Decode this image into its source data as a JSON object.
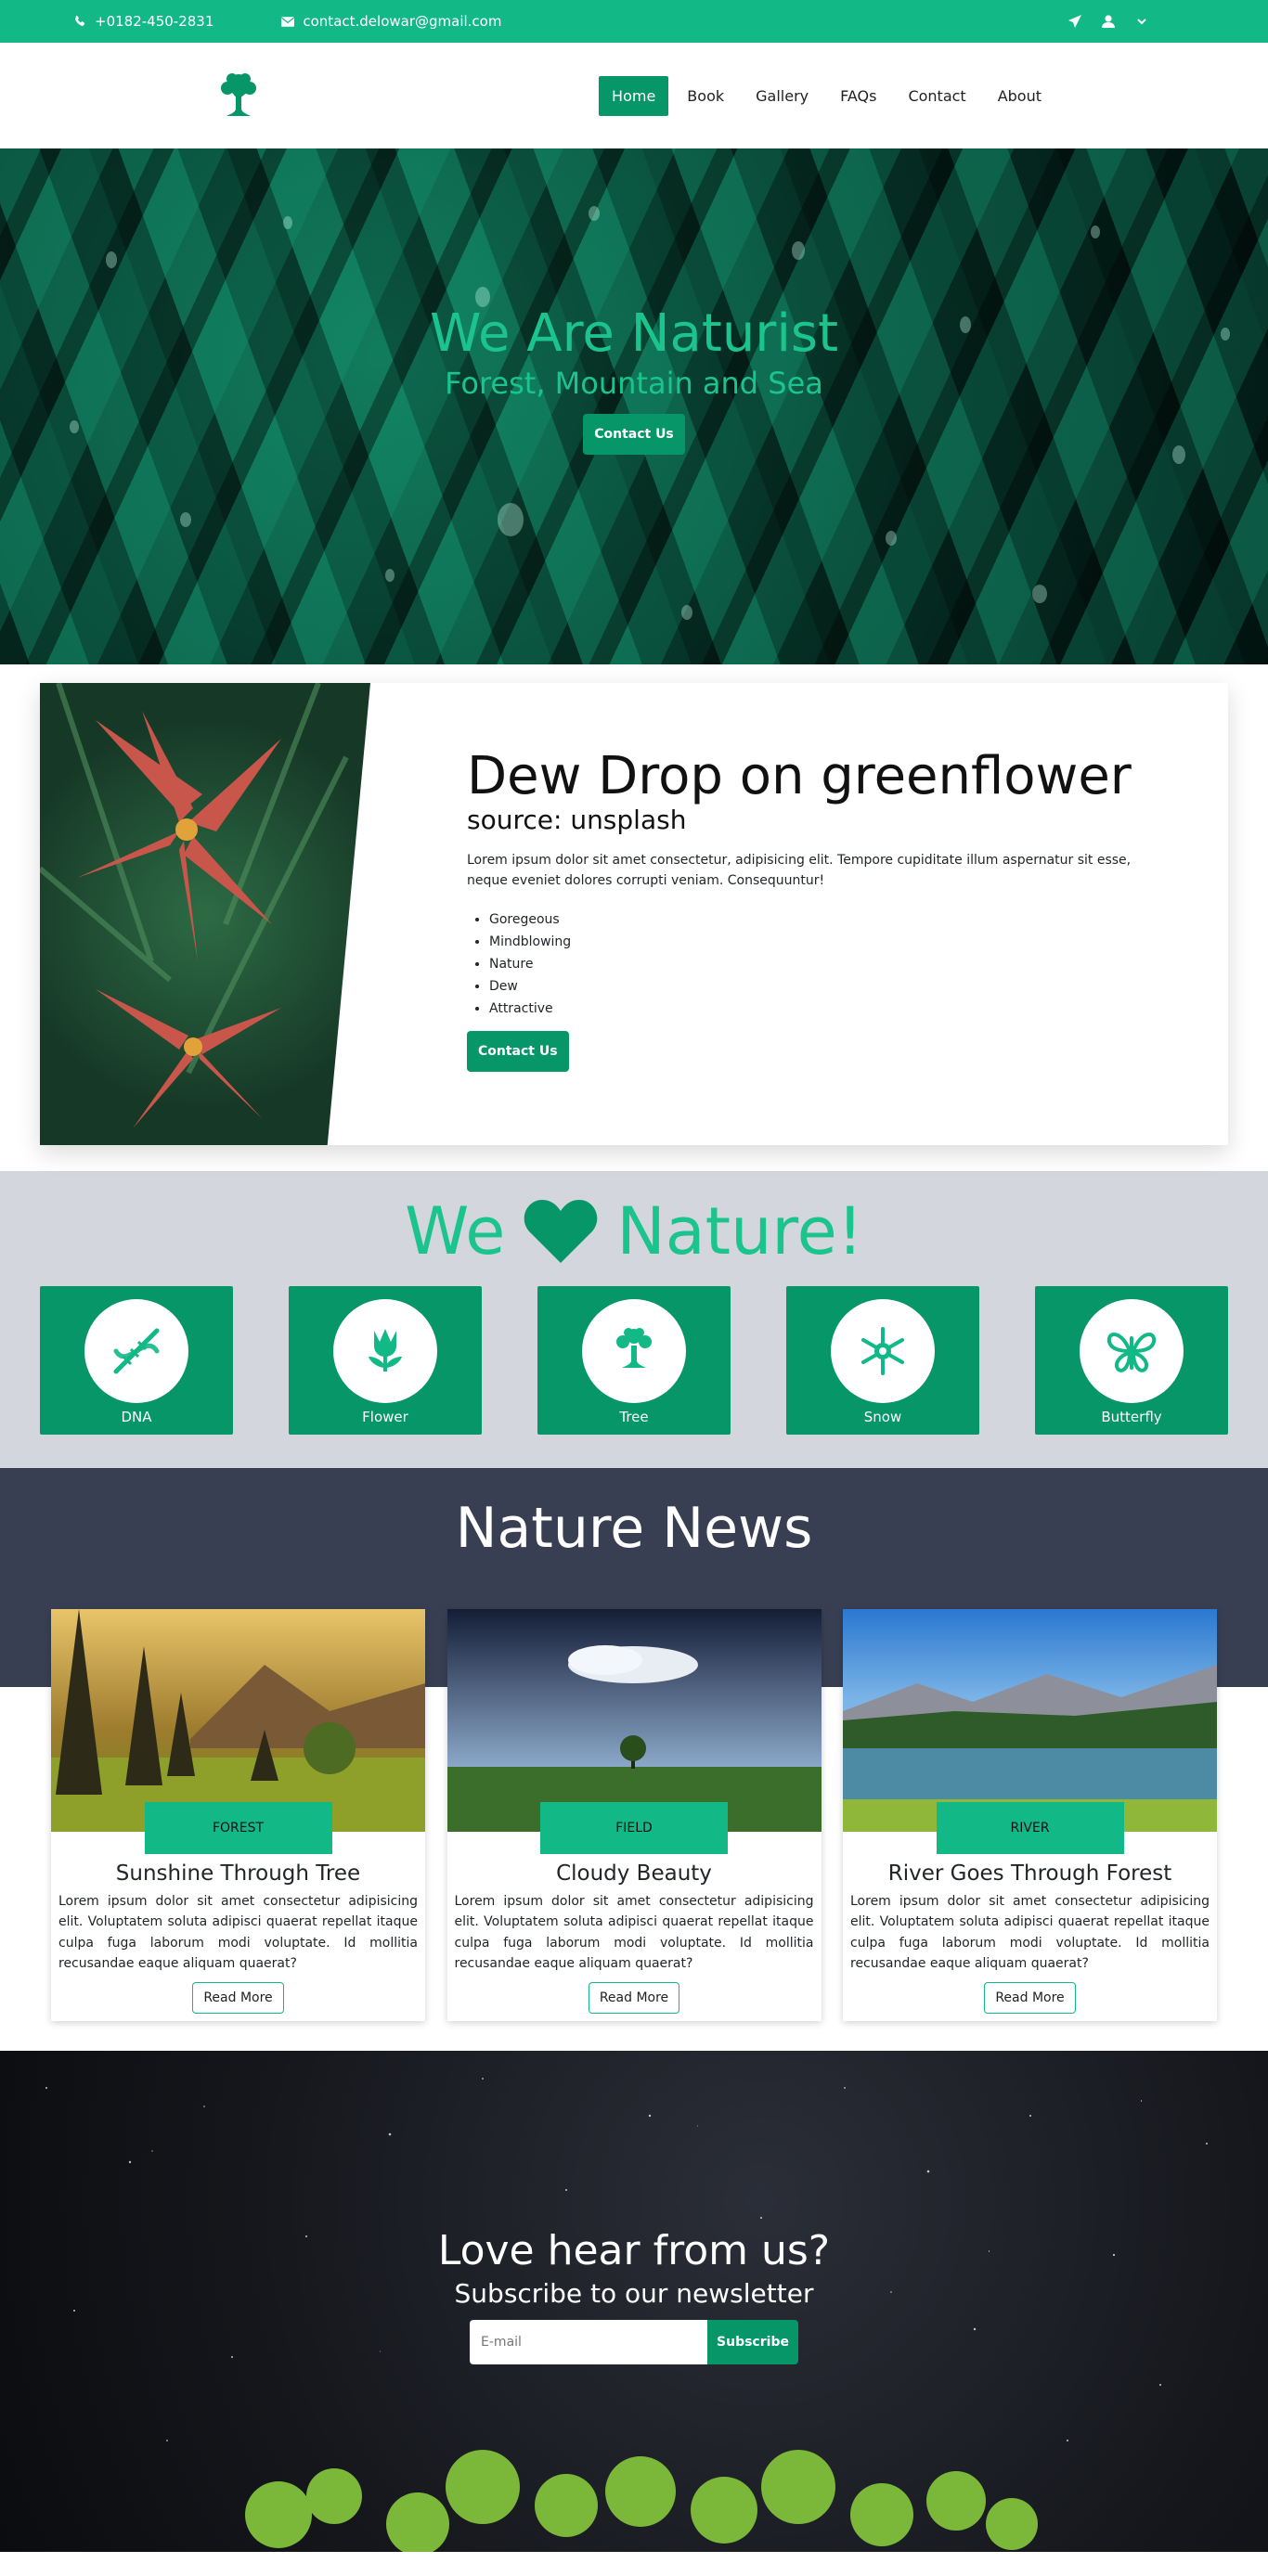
{
  "topbar": {
    "phone": "+0182-450-2831",
    "email": "contact.delowar@gmail.com"
  },
  "nav": {
    "items": [
      "Home",
      "Book",
      "Gallery",
      "FAQs",
      "Contact",
      "About"
    ]
  },
  "hero": {
    "title": "We Are Naturist",
    "subtitle": "Forest, Mountain and Sea",
    "button": "Contact Us"
  },
  "feature": {
    "title": "Dew Drop on greenflower",
    "source": "source: unsplash",
    "text": "Lorem ipsum dolor sit amet consectetur, adipisicing elit. Tempore cupiditate illum aspernatur sit esse, neque eveniet dolores corrupti veniam. Consequuntur!",
    "list": [
      "Goregeous",
      "Mindblowing",
      "Nature",
      "Dew",
      "Attractive"
    ],
    "button": "Contact Us"
  },
  "love": {
    "left": "We",
    "right": "Nature!",
    "cards": [
      "DNA",
      "Flower",
      "Tree",
      "Snow",
      "Butterfly"
    ]
  },
  "news": {
    "title": "Nature News",
    "cards": [
      {
        "tag": "FOREST",
        "title": "Sunshine Through Tree",
        "text": "Lorem ipsum dolor sit amet consectetur adipisicing elit. Voluptatem soluta adipisci quaerat repellat itaque culpa fuga laborum modi voluptate. Id mollitia recusandae eaque aliquam quaerat?",
        "button": "Read More"
      },
      {
        "tag": "FIELD",
        "title": "Cloudy Beauty",
        "text": "Lorem ipsum dolor sit amet consectetur adipisicing elit. Voluptatem soluta adipisci quaerat repellat itaque culpa fuga laborum modi voluptate. Id mollitia recusandae eaque aliquam quaerat?",
        "button": "Read More"
      },
      {
        "tag": "RIVER",
        "title": "River Goes Through Forest",
        "text": "Lorem ipsum dolor sit amet consectetur adipisicing elit. Voluptatem soluta adipisci quaerat repellat itaque culpa fuga laborum modi voluptate. Id mollitia recusandae eaque aliquam quaerat?",
        "button": "Read More"
      }
    ]
  },
  "subscribe": {
    "title": "Love hear from us?",
    "subtitle": "Subscribe to our newsletter",
    "placeholder": "E-mail",
    "button": "Subscribe"
  },
  "colors": {
    "brand": "#12b886",
    "brand_dark": "#069668",
    "news_band": "#383f52",
    "love_bg": "#d3d6dc"
  }
}
